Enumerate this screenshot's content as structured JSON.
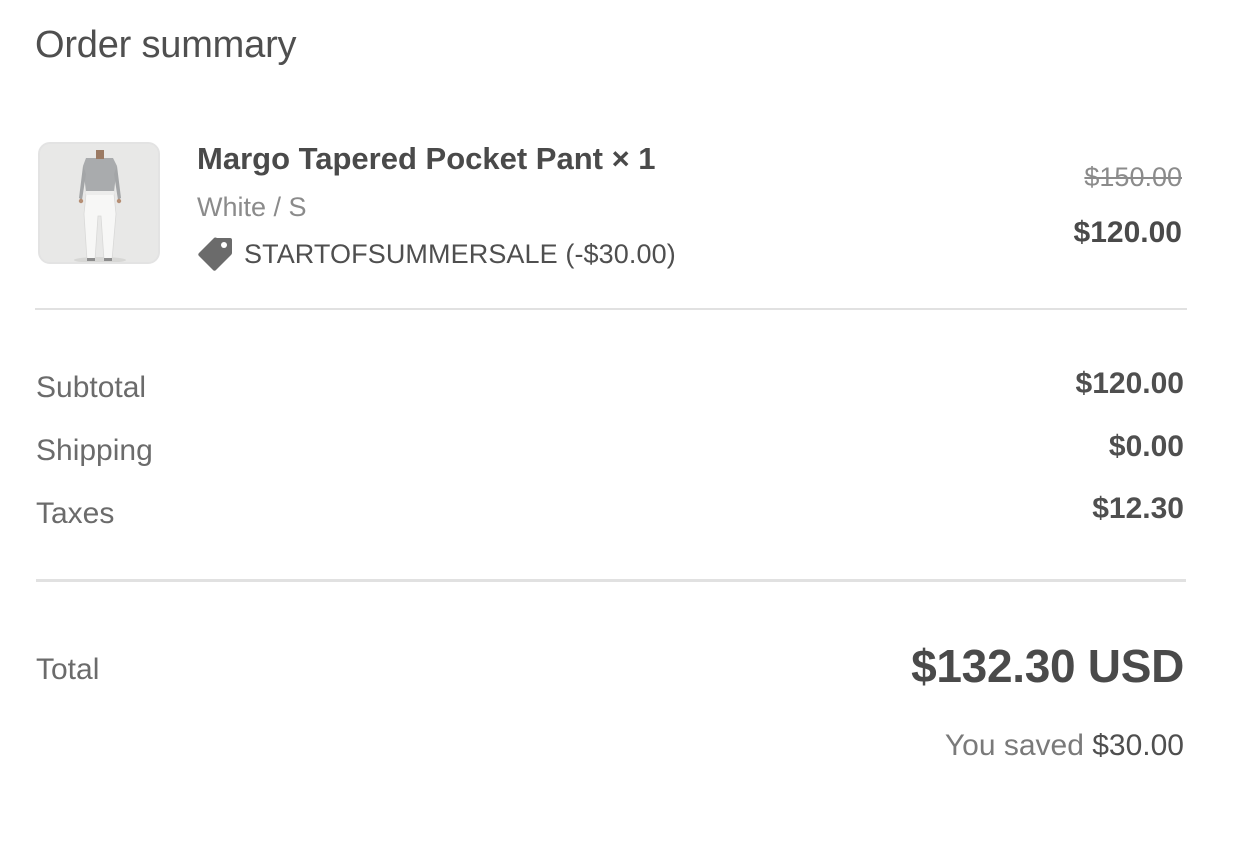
{
  "section": {
    "title": "Order summary"
  },
  "line_item": {
    "name": "Margo Tapered Pocket Pant × 1",
    "variant": "White / S",
    "discount_icon": "tag-icon",
    "discount_label": "STARTOFSUMMERSALE (-$30.00)",
    "original_price": "$150.00",
    "price": "$120.00"
  },
  "summary": {
    "rows": [
      {
        "label": "Subtotal",
        "value": "$120.00"
      },
      {
        "label": "Shipping",
        "value": "$0.00"
      },
      {
        "label": "Taxes",
        "value": "$12.30"
      }
    ]
  },
  "total": {
    "label": "Total",
    "value": "$132.30 USD",
    "saved_prefix": "You saved",
    "saved_amount": "$30.00"
  },
  "colors": {
    "text_primary": "#4a4a4a",
    "text_secondary": "#8b8b8b",
    "divider": "#e1e1e1",
    "thumbnail_bg": "#e9e9e8"
  }
}
